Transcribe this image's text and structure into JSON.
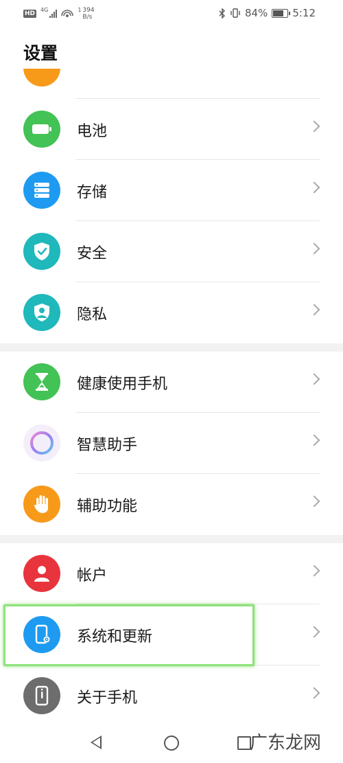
{
  "status_bar": {
    "hd": "HD",
    "network": "4G",
    "sim_index": "1",
    "speed_value": "394",
    "speed_unit": "B/s",
    "battery_percent": 84,
    "battery_text": "84%",
    "time": "5:12"
  },
  "page": {
    "title": "设置"
  },
  "settings_groups": [
    {
      "items": [
        {
          "id": "battery",
          "label": "电池",
          "icon": "battery-icon",
          "color": "#43c255"
        },
        {
          "id": "storage",
          "label": "存储",
          "icon": "storage-icon",
          "color": "#1e9bf0"
        },
        {
          "id": "security",
          "label": "安全",
          "icon": "shield-check-icon",
          "color": "#1fb8bb"
        },
        {
          "id": "privacy",
          "label": "隐私",
          "icon": "privacy-shield-icon",
          "color": "#1fb8bb"
        }
      ]
    },
    {
      "items": [
        {
          "id": "digital-balance",
          "label": "健康使用手机",
          "icon": "hourglass-icon",
          "color": "#43c255"
        },
        {
          "id": "smart-assistant",
          "label": "智慧助手",
          "icon": "assistant-ring-icon",
          "color": "#f4eefa"
        },
        {
          "id": "accessibility",
          "label": "辅助功能",
          "icon": "hand-icon",
          "color": "#f79a1a"
        }
      ]
    },
    {
      "items": [
        {
          "id": "accounts",
          "label": "帐户",
          "icon": "user-icon",
          "color": "#e8343d"
        },
        {
          "id": "system-update",
          "label": "系统和更新",
          "icon": "phone-gear-icon",
          "color": "#1e9bf0"
        },
        {
          "id": "about-phone",
          "label": "关于手机",
          "icon": "phone-info-icon",
          "color": "#6d6d6d"
        }
      ]
    }
  ],
  "colors": {
    "highlight": "#8ee27a",
    "partial_item": "#f79a1a"
  },
  "navigation": {
    "back": "back-icon",
    "home": "home-icon",
    "recent": "recent-apps-icon"
  },
  "watermark": "广东龙网"
}
